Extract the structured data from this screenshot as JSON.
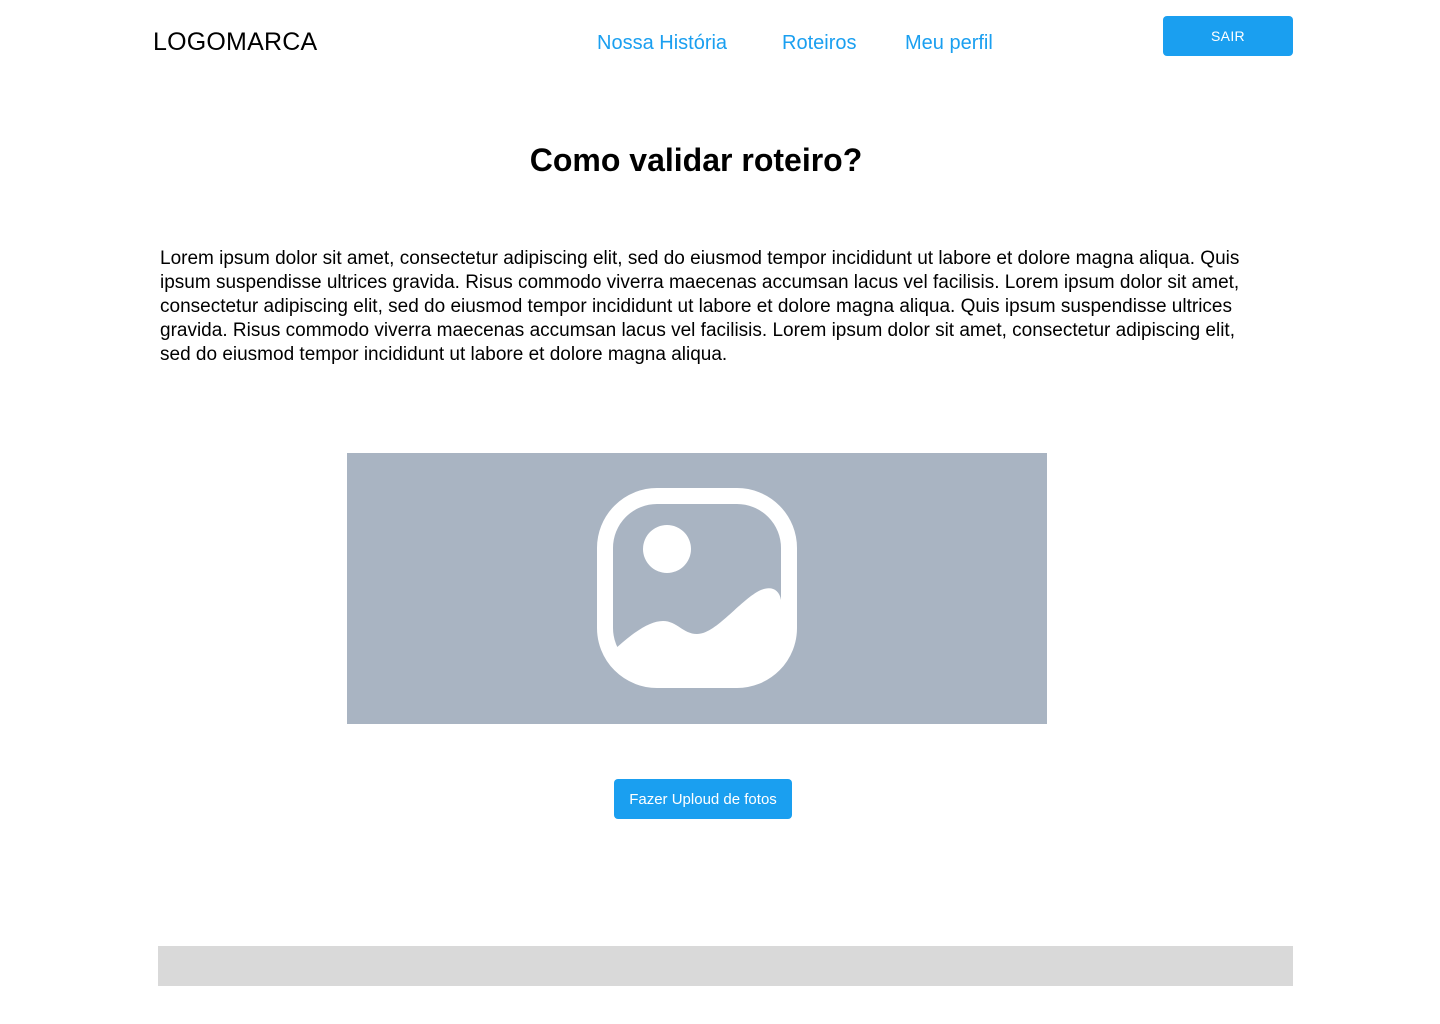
{
  "header": {
    "logo": "LOGOMARCA",
    "nav": {
      "nossa_historia": "Nossa História",
      "roteiros": "Roteiros",
      "meu_perfil": "Meu perfil"
    },
    "logout_label": "SAIR"
  },
  "main": {
    "title": "Como validar roteiro?",
    "paragraph": "Lorem ipsum dolor sit amet, consectetur adipiscing elit, sed do eiusmod tempor incididunt ut labore et dolore magna aliqua. Quis ipsum suspendisse ultrices gravida. Risus commodo viverra maecenas accumsan lacus vel facilisis. Lorem ipsum dolor sit amet, consectetur adipiscing elit, sed do eiusmod tempor incididunt ut labore et dolore magna aliqua. Quis ipsum suspendisse ultrices gravida. Risus commodo viverra maecenas accumsan lacus vel facilisis. Lorem ipsum dolor sit amet, consectetur adipiscing elit, sed do eiusmod tempor incididunt ut labore et dolore magna aliqua.",
    "image_icon": "image-icon",
    "upload_label": "Fazer Uploud de fotos"
  },
  "colors": {
    "accent": "#1a9ff0",
    "image_placeholder": "#a9b4c2",
    "footer": "#d9d9d9"
  }
}
